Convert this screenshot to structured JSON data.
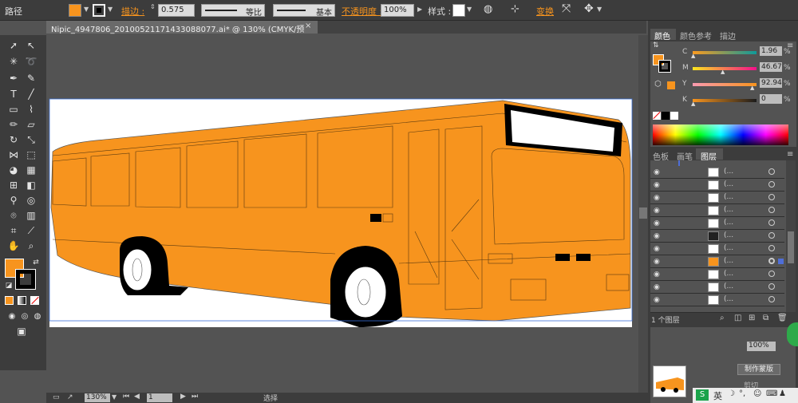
{
  "control_bar": {
    "object_type": "路径",
    "stroke_label": "描边 :",
    "stroke_weight": "0.575",
    "profile_label": "等比",
    "brush_label": "基本",
    "opacity_label": "不透明度 :",
    "opacity_value": "100%",
    "style_label": "样式 :",
    "transform_label": "变换",
    "fill_color": "#f7941e",
    "stroke_color": "#000000"
  },
  "document": {
    "tab_title": "Nipic_4947806_20100521171433088077.ai* @ 130% (CMYK/预览)",
    "close": "×"
  },
  "status_bar": {
    "zoom": "130%",
    "artboard_num": "1",
    "tool_status": "选择"
  },
  "color_panel": {
    "tabs": [
      "颜色",
      "颜色参考",
      "描边"
    ],
    "channels": [
      {
        "name": "C",
        "value": "1.96",
        "unit": "%",
        "fraction": 0.0196
      },
      {
        "name": "M",
        "value": "46.67",
        "unit": "%",
        "fraction": 0.4667
      },
      {
        "name": "Y",
        "value": "92.94",
        "unit": "%",
        "fraction": 0.9294
      },
      {
        "name": "K",
        "value": "0",
        "unit": "%",
        "fraction": 0
      }
    ],
    "fill_color": "#f7941e"
  },
  "layers_panel": {
    "tabs": [
      "色板",
      "画笔",
      "图层"
    ],
    "rows": [
      "(...",
      "(...",
      "(...",
      "(...",
      "(...",
      "(...",
      "(...",
      "(...",
      "(...",
      "(...",
      "(...",
      "(..."
    ],
    "footer": "1 个图层"
  },
  "lower_panel": {
    "opacity": "100%",
    "make_mask_button": "制作蒙版",
    "clip_label": "剪切"
  },
  "watermark": {
    "ime_lang": "英"
  }
}
